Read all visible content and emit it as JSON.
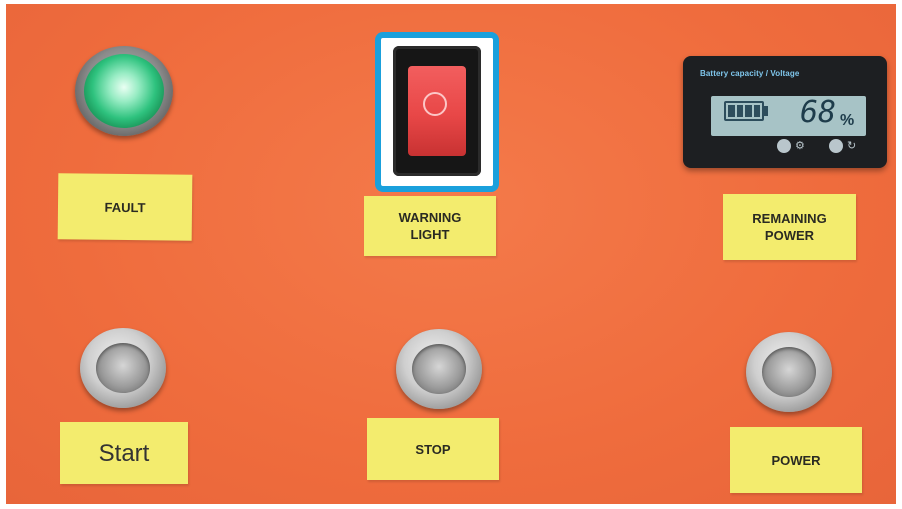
{
  "labels": {
    "fault": "FAULT",
    "warning_light": "WARNING\nLIGHT",
    "remaining_power": "REMAINING\nPOWER",
    "start": "Start",
    "stop": "STOP",
    "power": "POWER"
  },
  "battery_display": {
    "title": "Battery capacity / Voltage",
    "value": "68",
    "unit": "%"
  },
  "switch_symbol": "O",
  "highlight_color": "#1aa0dc",
  "panel_color": "#ef6c3d",
  "lamp_color": "#2ec27e"
}
